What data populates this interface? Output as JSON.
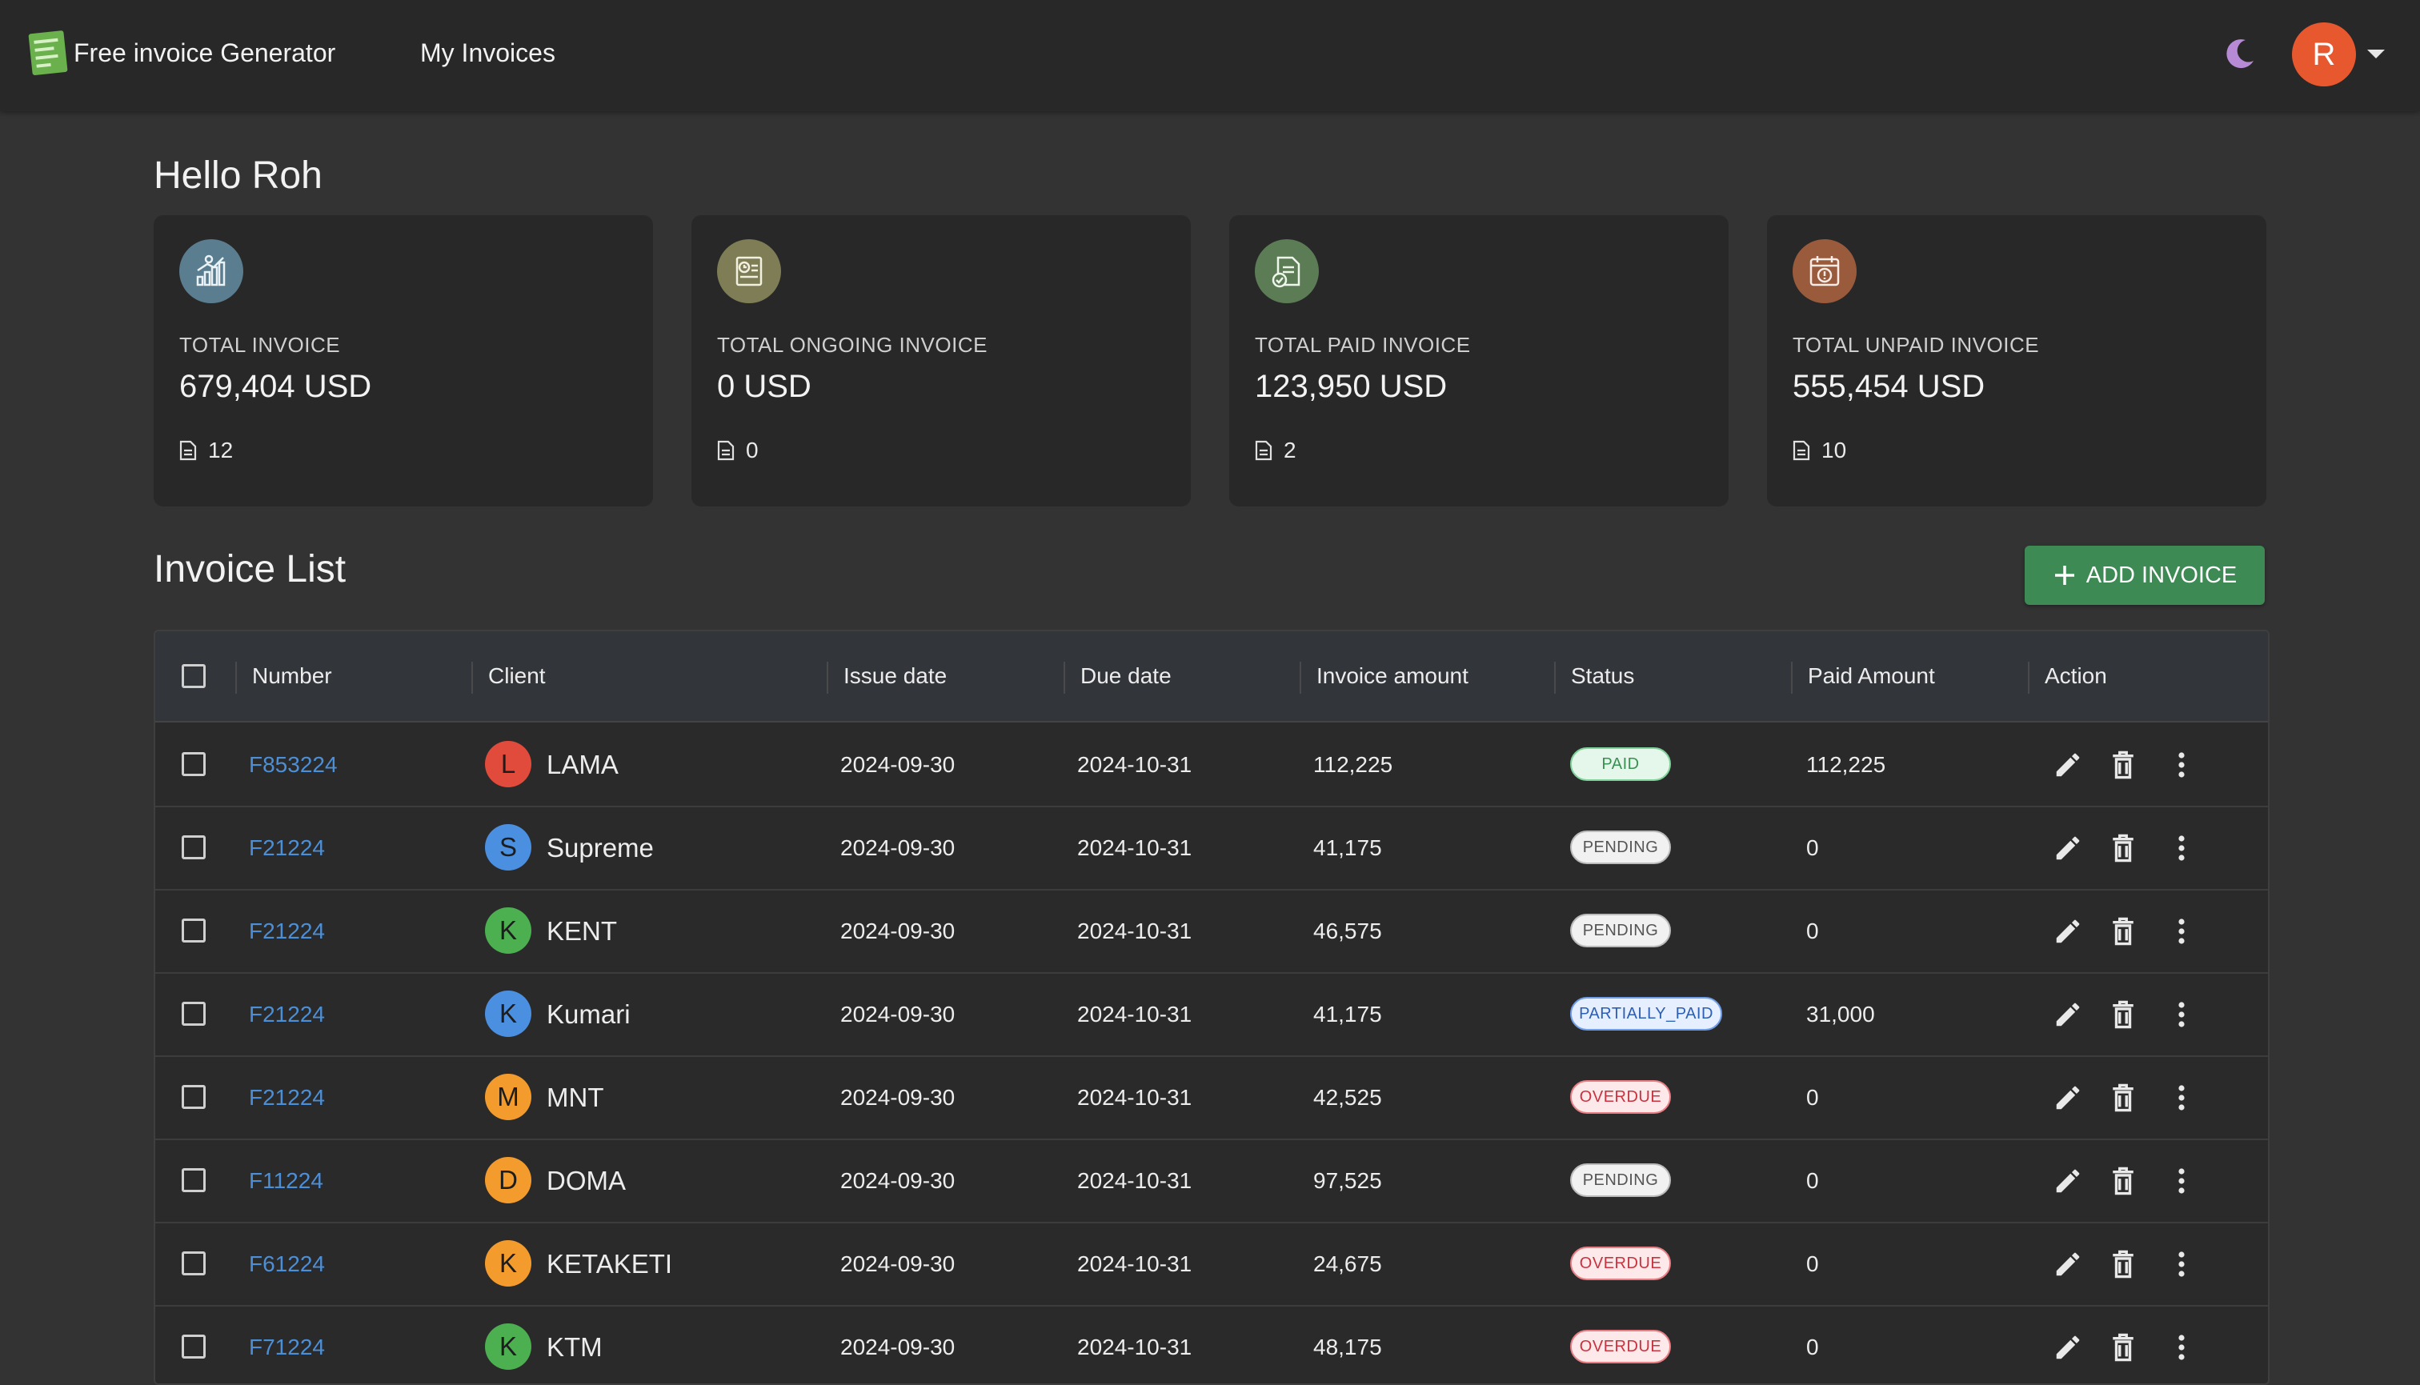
{
  "header": {
    "brand": "Free invoice Generator",
    "nav_my_invoices": "My Invoices",
    "user_initial": "R"
  },
  "greeting": "Hello Roh",
  "cards": [
    {
      "label": "TOTAL INVOICE",
      "value": "679,404 USD",
      "count": "12",
      "color": "#5a7d8f"
    },
    {
      "label": "TOTAL ONGOING INVOICE",
      "value": "0 USD",
      "count": "0",
      "color": "#7e7d56"
    },
    {
      "label": "TOTAL PAID INVOICE",
      "value": "123,950 USD",
      "count": "2",
      "color": "#5b7c55"
    },
    {
      "label": "TOTAL UNPAID INVOICE",
      "value": "555,454 USD",
      "count": "10",
      "color": "#9a5a3c"
    }
  ],
  "invoice_list": {
    "title": "Invoice List",
    "add_button": "ADD INVOICE",
    "columns": [
      "Number",
      "Client",
      "Issue date",
      "Due date",
      "Invoice amount",
      "Status",
      "Paid Amount",
      "Action"
    ],
    "rows": [
      {
        "number": "F853224",
        "initial": "L",
        "client": "LAMA",
        "avatar_color": "#e14b3b",
        "issue": "2024-09-30",
        "due": "2024-10-31",
        "amount": "112,225",
        "status": "PAID",
        "paid": "112,225"
      },
      {
        "number": "F21224",
        "initial": "S",
        "client": "Supreme",
        "avatar_color": "#4b8fe0",
        "issue": "2024-09-30",
        "due": "2024-10-31",
        "amount": "41,175",
        "status": "PENDING",
        "paid": "0"
      },
      {
        "number": "F21224",
        "initial": "K",
        "client": "KENT",
        "avatar_color": "#4caf50",
        "issue": "2024-09-30",
        "due": "2024-10-31",
        "amount": "46,575",
        "status": "PENDING",
        "paid": "0"
      },
      {
        "number": "F21224",
        "initial": "K",
        "client": "Kumari",
        "avatar_color": "#4b8fe0",
        "issue": "2024-09-30",
        "due": "2024-10-31",
        "amount": "41,175",
        "status": "PARTIALLY_PAID",
        "paid": "31,000"
      },
      {
        "number": "F21224",
        "initial": "M",
        "client": "MNT",
        "avatar_color": "#f39c2d",
        "issue": "2024-09-30",
        "due": "2024-10-31",
        "amount": "42,525",
        "status": "OVERDUE",
        "paid": "0"
      },
      {
        "number": "F11224",
        "initial": "D",
        "client": "DOMA",
        "avatar_color": "#f39c2d",
        "issue": "2024-09-30",
        "due": "2024-10-31",
        "amount": "97,525",
        "status": "PENDING",
        "paid": "0"
      },
      {
        "number": "F61224",
        "initial": "K",
        "client": "KETAKETI",
        "avatar_color": "#f39c2d",
        "issue": "2024-09-30",
        "due": "2024-10-31",
        "amount": "24,675",
        "status": "OVERDUE",
        "paid": "0"
      },
      {
        "number": "F71224",
        "initial": "K",
        "client": "KTM",
        "avatar_color": "#4caf50",
        "issue": "2024-09-30",
        "due": "2024-10-31",
        "amount": "48,175",
        "status": "OVERDUE",
        "paid": "0"
      }
    ]
  },
  "colors": {
    "accent_green": "#3d8a54",
    "link_blue": "#4d8fd6",
    "avatar_orange": "#e8582f"
  }
}
